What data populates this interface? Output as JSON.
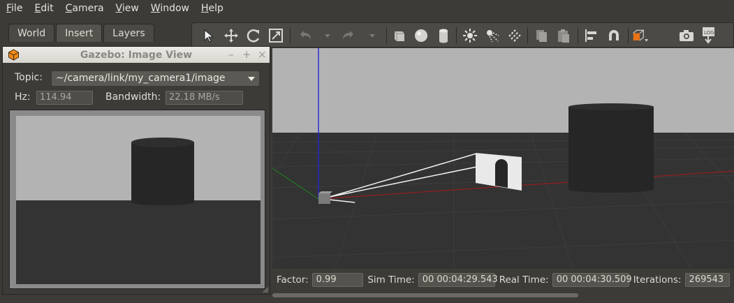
{
  "menu": {
    "items": [
      {
        "u": "F",
        "rest": "ile"
      },
      {
        "u": "E",
        "rest": "dit"
      },
      {
        "u": "C",
        "rest": "amera"
      },
      {
        "u": "V",
        "rest": "iew"
      },
      {
        "u": "W",
        "rest": "indow"
      },
      {
        "u": "H",
        "rest": "elp"
      }
    ]
  },
  "tabs": [
    "World",
    "Insert",
    "Layers"
  ],
  "toolbar": {
    "icons": [
      "select-arrow-icon",
      "translate-icon",
      "rotate-icon",
      "scale-icon",
      "undo-icon",
      "undo-menu-icon",
      "redo-icon",
      "redo-menu-icon",
      "box-icon",
      "sphere-icon",
      "cylinder-icon",
      "point-light-icon",
      "spot-light-icon",
      "directional-light-icon",
      "copy-icon",
      "paste-icon",
      "align-icon",
      "snap-icon",
      "view-angle-icon",
      "screenshot-icon",
      "log-icon"
    ]
  },
  "image_view": {
    "title": "Gazebo: Image View",
    "topic_label": "Topic:",
    "topic_value": "~/camera/link/my_camera1/image",
    "hz_label": "Hz:",
    "hz_value": "114.94",
    "bandwidth_label": "Bandwidth:",
    "bandwidth_value": "22.18 MB/s"
  },
  "status": {
    "factor_label": "Factor:",
    "factor_value": "0.99",
    "sim_time_label": "Sim Time:",
    "sim_time_value": "00 00:04:29.543",
    "real_time_label": "Real Time:",
    "real_time_value": "00 00:04:30.509",
    "iterations_label": "Iterations:",
    "iterations_value": "269543"
  },
  "colors": {
    "toolbar_accent": "#e8731a",
    "axis_x": "#b22222",
    "axis_y": "#2e8b2e",
    "axis_z": "#2626d9"
  }
}
